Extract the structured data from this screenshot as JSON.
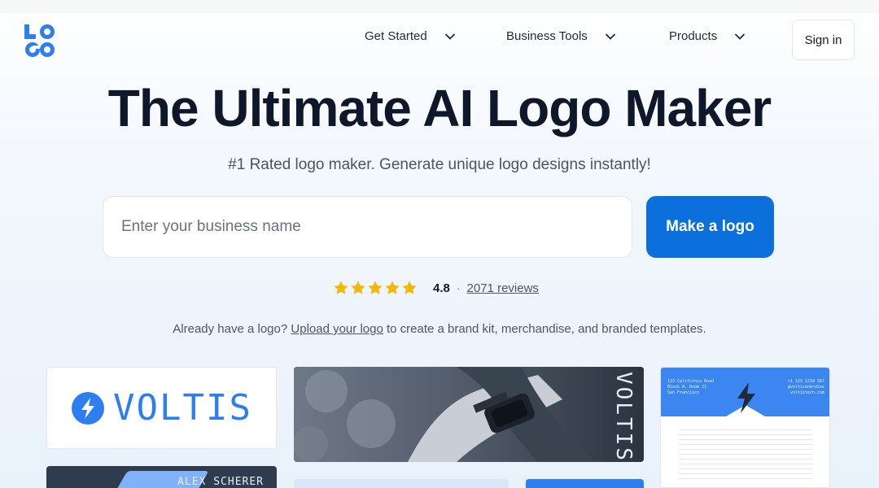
{
  "brand": {
    "logo_alt": "LOGO",
    "accent": "#0b6fdc"
  },
  "nav": {
    "items": [
      {
        "label": "Get Started"
      },
      {
        "label": "Business Tools"
      },
      {
        "label": "Products"
      }
    ],
    "sign_in": "Sign in"
  },
  "hero": {
    "title": "The Ultimate AI Logo Maker",
    "subtitle": "#1 Rated logo maker. Generate unique logo designs instantly!",
    "search_placeholder": "Enter your business name",
    "search_value": "",
    "cta": "Make a logo"
  },
  "rating": {
    "value": "4.8",
    "separator": "·",
    "reviews": "2071 reviews",
    "stars": 5,
    "star_color": "#f5b800"
  },
  "upload": {
    "prefix": "Already have a logo?",
    "link": "Upload your logo",
    "suffix": "to create a brand kit, merchandise, and branded templates."
  },
  "gallery": {
    "brand_word": "VOLTIS",
    "card_name": "ALEX SCHERER",
    "letterhead_address": [
      "123 California Road",
      "Block A, Room 21",
      "San Francisco"
    ],
    "letterhead_contact": [
      "+1 123 1234 567",
      "@voltisenerdies",
      "voltistech.com"
    ]
  }
}
